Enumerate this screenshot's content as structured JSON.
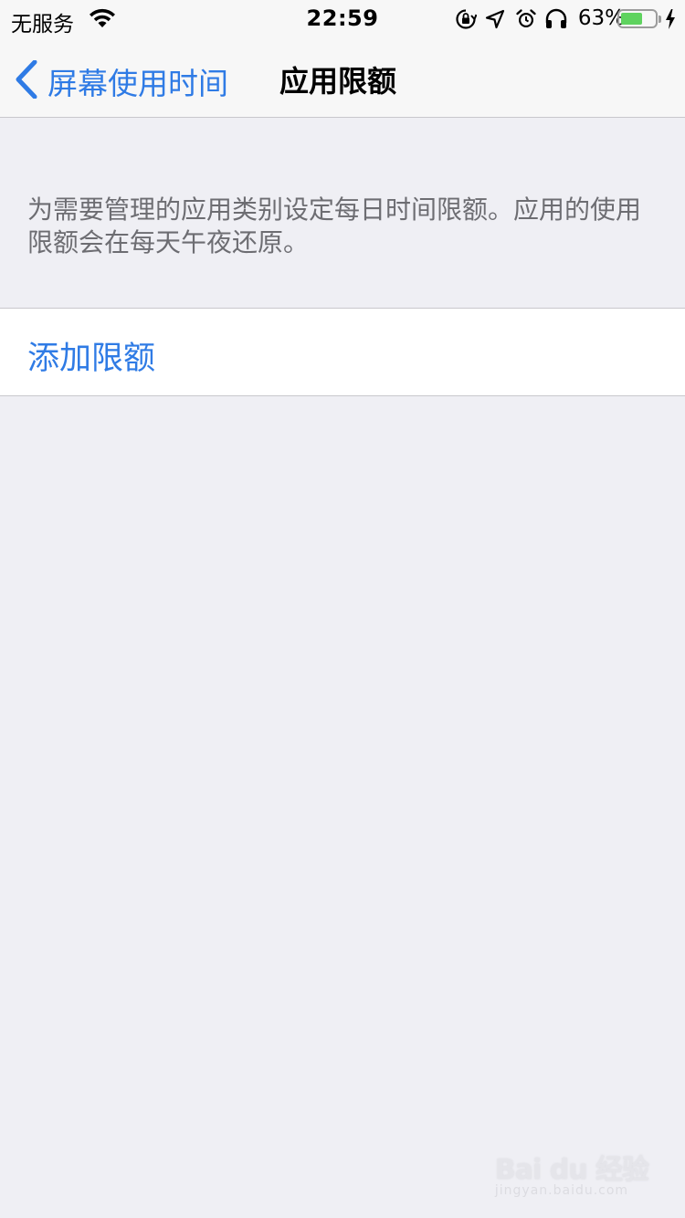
{
  "status_bar": {
    "carrier": "无服务",
    "time": "22:59",
    "battery_percent": "63%",
    "battery_level": 0.63,
    "icons": [
      "wifi-icon",
      "rotation-lock-icon",
      "location-icon",
      "alarm-icon",
      "headphones-icon",
      "battery-icon",
      "charging-icon"
    ]
  },
  "nav": {
    "back_label": "屏幕使用时间",
    "title": "应用限额"
  },
  "content": {
    "description": "为需要管理的应用类别设定每日时间限额。应用的使用限额会在每天午夜还原。",
    "add_limit_label": "添加限额"
  },
  "watermark": {
    "main": "Bai du 经验",
    "sub": "jingyan.baidu.com"
  },
  "colors": {
    "accent": "#2F7BE5",
    "background": "#EFEFF4",
    "nav_background": "#F7F7F7",
    "secondary_text": "#6D6D72",
    "battery_fill": "#5FD35F"
  }
}
